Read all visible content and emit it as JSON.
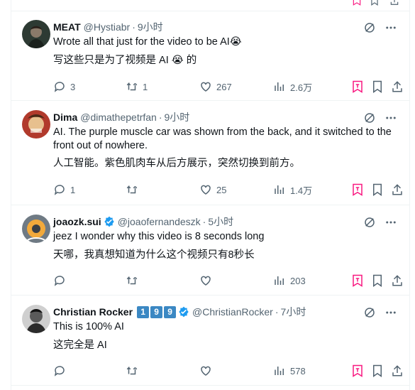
{
  "tweets": [
    {
      "name": "MEAT",
      "handle": "@Hystiabr",
      "dot": "·",
      "time": "9小时",
      "text_en": "Wrote all that just for the video to be AI😭",
      "text_zh": "写这些只是为了视频是 AI 😭 的",
      "replies": "3",
      "retweets": "1",
      "likes": "267",
      "views": "2.6万"
    },
    {
      "name": "Dima",
      "handle": "@dimathepetrfan",
      "dot": "·",
      "time": "9小时",
      "text_en": "AI. The purple muscle car was shown from the back, and it switched to the front out of nowhere.",
      "text_zh": "人工智能。紫色肌肉车从后方展示，突然切换到前方。",
      "replies": "1",
      "retweets": "",
      "likes": "25",
      "views": "1.4万"
    },
    {
      "name": "joaozk.sui",
      "handle": "@joaofernandeszk",
      "dot": "·",
      "time": "5小时",
      "text_en": "jeez I wonder why this video is 8 seconds long",
      "text_zh": "天哪，我真想知道为什么这个视频只有8秒长",
      "replies": "",
      "retweets": "",
      "likes": "",
      "views": "203"
    },
    {
      "name": "Christian Rocker",
      "badges": [
        "1",
        "9",
        "9"
      ],
      "handle": "@ChristianRocker",
      "dot": "·",
      "time": "7小时",
      "text_en": "This is 100% AI",
      "text_zh": "这完全是 AI",
      "replies": "",
      "retweets": "",
      "likes": "",
      "views": "578"
    }
  ],
  "icons": {
    "reply": "reply-icon",
    "retweet": "retweet-icon",
    "like": "heart-icon",
    "views": "views-icon",
    "grok": "grok-icon",
    "more": "more-icon",
    "verified": "verified-badge-icon",
    "bookmark": "bookmark-icon",
    "share": "share-icon",
    "translate": "translate-icon"
  },
  "colors": {
    "accent": "#1d9bf0",
    "muted": "#536471",
    "text": "#0f1419",
    "pink": "#f91880",
    "badge": "#3b88c3"
  }
}
